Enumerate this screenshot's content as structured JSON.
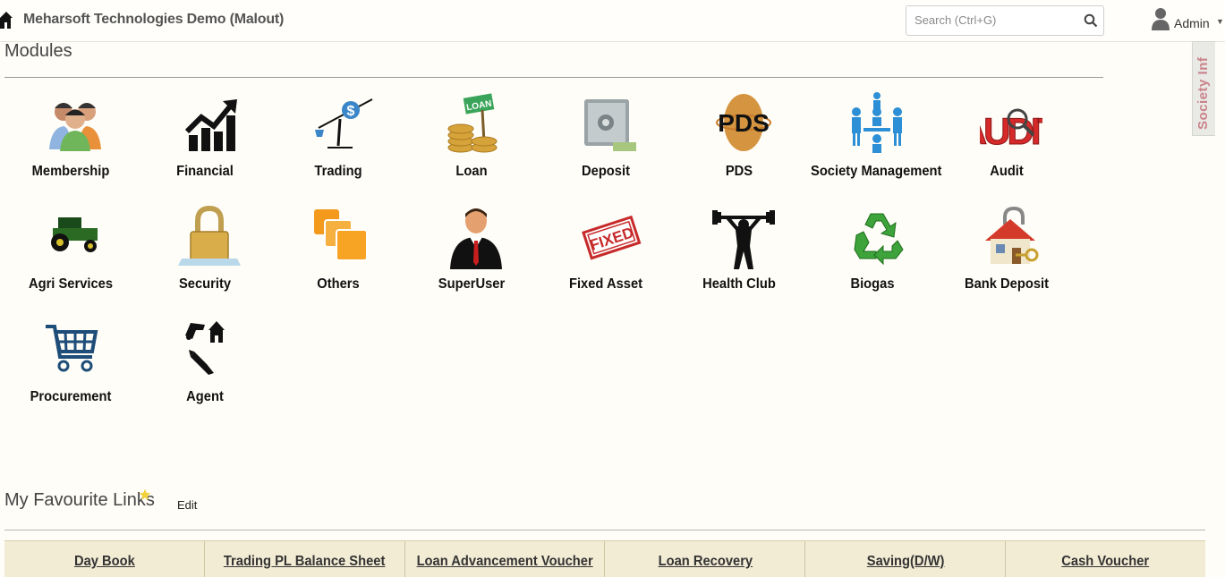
{
  "header": {
    "title": "Meharsoft Technologies Demo (Malout)",
    "search_placeholder": "Search (Ctrl+G)",
    "user_label": "Admin",
    "home_icon": "home-icon",
    "user_icon": "user-icon"
  },
  "side_tab": {
    "label": "Society Inf"
  },
  "modules": {
    "title": "Modules",
    "items": [
      {
        "label": "Membership",
        "icon": "membership-icon"
      },
      {
        "label": "Financial",
        "icon": "financial-chart-icon"
      },
      {
        "label": "Trading",
        "icon": "trading-scale-icon"
      },
      {
        "label": "Loan",
        "icon": "loan-coins-icon"
      },
      {
        "label": "Deposit",
        "icon": "safe-icon"
      },
      {
        "label": "PDS",
        "icon": "pds-icon"
      },
      {
        "label": "Society Management",
        "icon": "meeting-icon"
      },
      {
        "label": "Audit",
        "icon": "audit-icon"
      },
      {
        "label": "Agri Services",
        "icon": "tractor-icon"
      },
      {
        "label": "Security",
        "icon": "padlock-icon"
      },
      {
        "label": "Others",
        "icon": "stacked-squares-icon"
      },
      {
        "label": "SuperUser",
        "icon": "businessman-icon"
      },
      {
        "label": "Fixed Asset",
        "icon": "fixed-stamp-icon"
      },
      {
        "label": "Health Club",
        "icon": "weightlifter-icon"
      },
      {
        "label": "Biogas",
        "icon": "recycle-icon"
      },
      {
        "label": "Bank Deposit",
        "icon": "house-key-icon"
      },
      {
        "label": "Procurement",
        "icon": "shopping-cart-icon"
      },
      {
        "label": "Agent",
        "icon": "agent-icon"
      }
    ]
  },
  "favourites": {
    "title": "My Favourite Links",
    "edit_label": "Edit",
    "links": [
      "Day Book",
      "Trading PL Balance Sheet",
      "Loan Advancement Voucher",
      "Loan Recovery",
      "Saving(D/W)",
      "Cash Voucher"
    ]
  },
  "colors": {
    "background": "#fffdf7",
    "fav_row": "#f3ecd5",
    "accent_star": "#f2d23c",
    "side_tab_text": "#c9848a"
  }
}
